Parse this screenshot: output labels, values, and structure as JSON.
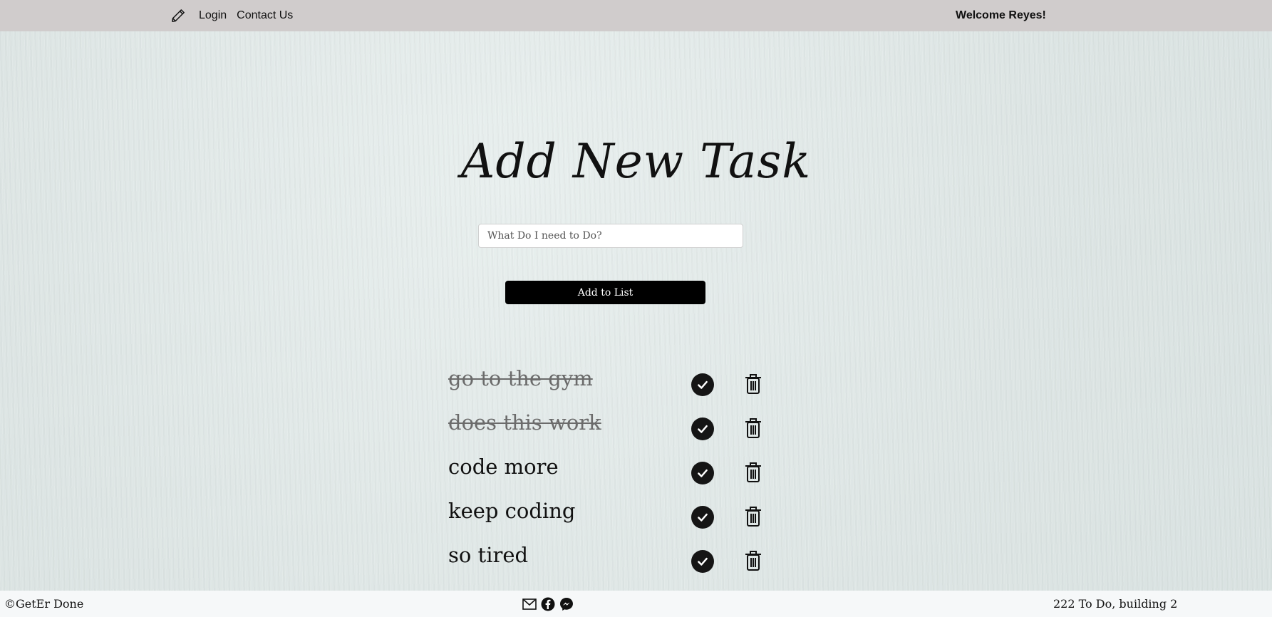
{
  "navbar": {
    "brand_icon": "pencil-icon",
    "links": [
      {
        "label": "Login"
      },
      {
        "label": "Contact Us"
      }
    ],
    "welcome": "Welcome Reyes!",
    "background": "#d0cccc"
  },
  "main": {
    "title": "Add New Task",
    "input": {
      "value": "",
      "placeholder": "What Do I need to Do?"
    },
    "add_button_label": "Add to List"
  },
  "tasks": [
    {
      "text": "go to the gym",
      "completed": true
    },
    {
      "text": "does this work",
      "completed": true
    },
    {
      "text": "code more",
      "completed": false
    },
    {
      "text": "keep coding",
      "completed": false
    },
    {
      "text": "so tired",
      "completed": false
    }
  ],
  "task_icons": {
    "complete": "check-circle-icon",
    "delete": "trash-icon"
  },
  "footer": {
    "copyright": "©GetEr Done",
    "icons": [
      "envelope-icon",
      "facebook-icon",
      "messenger-icon"
    ],
    "address": "222 To Do, building 2"
  }
}
